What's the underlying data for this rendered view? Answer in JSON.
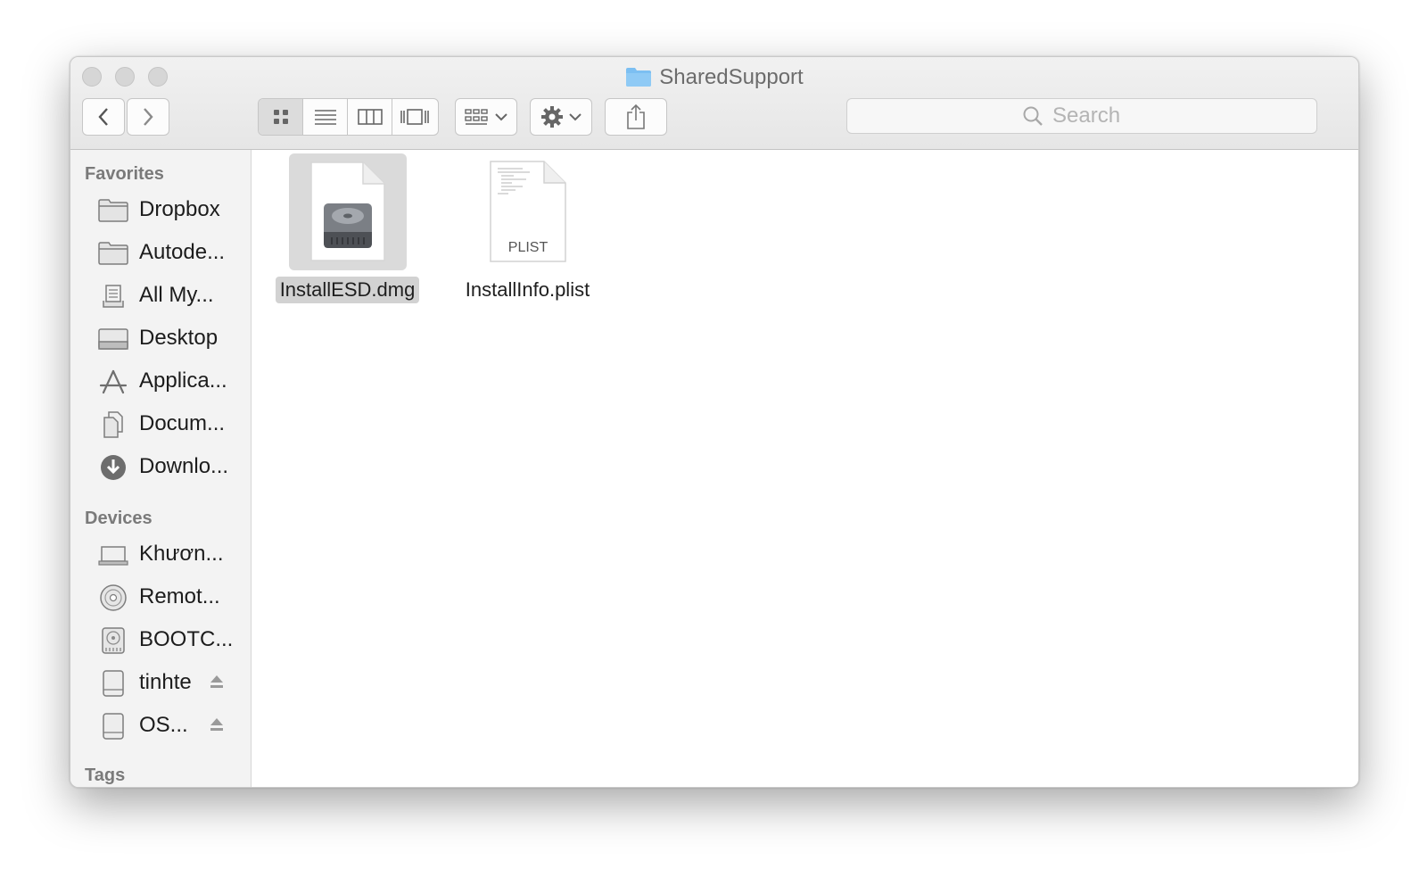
{
  "window": {
    "title": "SharedSupport",
    "title_icon": "folder-icon",
    "accent_folder_color": "#7cbff2"
  },
  "toolbar": {
    "back_icon": "chevron-left-icon",
    "forward_icon": "chevron-right-icon",
    "view_modes": [
      "icon-view",
      "list-view",
      "column-view",
      "cover-flow-view"
    ],
    "active_view": "icon-view",
    "arrange_icon": "arrange-grid-icon",
    "action_icon": "gear-icon",
    "share_icon": "share-icon",
    "search_placeholder": "Search"
  },
  "sidebar": {
    "favorites_header": "Favorites",
    "favorites": [
      {
        "label": "Dropbox",
        "icon": "folder-icon"
      },
      {
        "label": "Autode...",
        "icon": "folder-icon"
      },
      {
        "label": "All My...",
        "icon": "all-my-files-icon"
      },
      {
        "label": "Desktop",
        "icon": "desktop-icon"
      },
      {
        "label": "Applica...",
        "icon": "applications-icon"
      },
      {
        "label": "Docum...",
        "icon": "documents-icon"
      },
      {
        "label": "Downlo...",
        "icon": "downloads-icon"
      }
    ],
    "devices_header": "Devices",
    "devices": [
      {
        "label": "Khươn...",
        "icon": "laptop-icon",
        "eject": false
      },
      {
        "label": "Remot...",
        "icon": "remote-disc-icon",
        "eject": false
      },
      {
        "label": "BOOTC...",
        "icon": "internal-disk-icon",
        "eject": false
      },
      {
        "label": "tinhte",
        "icon": "external-drive-icon",
        "eject": true
      },
      {
        "label": "OS...",
        "icon": "external-drive-icon",
        "eject": true
      }
    ],
    "tags_header": "Tags"
  },
  "files": [
    {
      "name": "InstallESD.dmg",
      "icon": "disk-image-icon",
      "selected": true
    },
    {
      "name": "InstallInfo.plist",
      "icon": "plist-document-icon",
      "badge": "PLIST",
      "selected": false
    }
  ]
}
